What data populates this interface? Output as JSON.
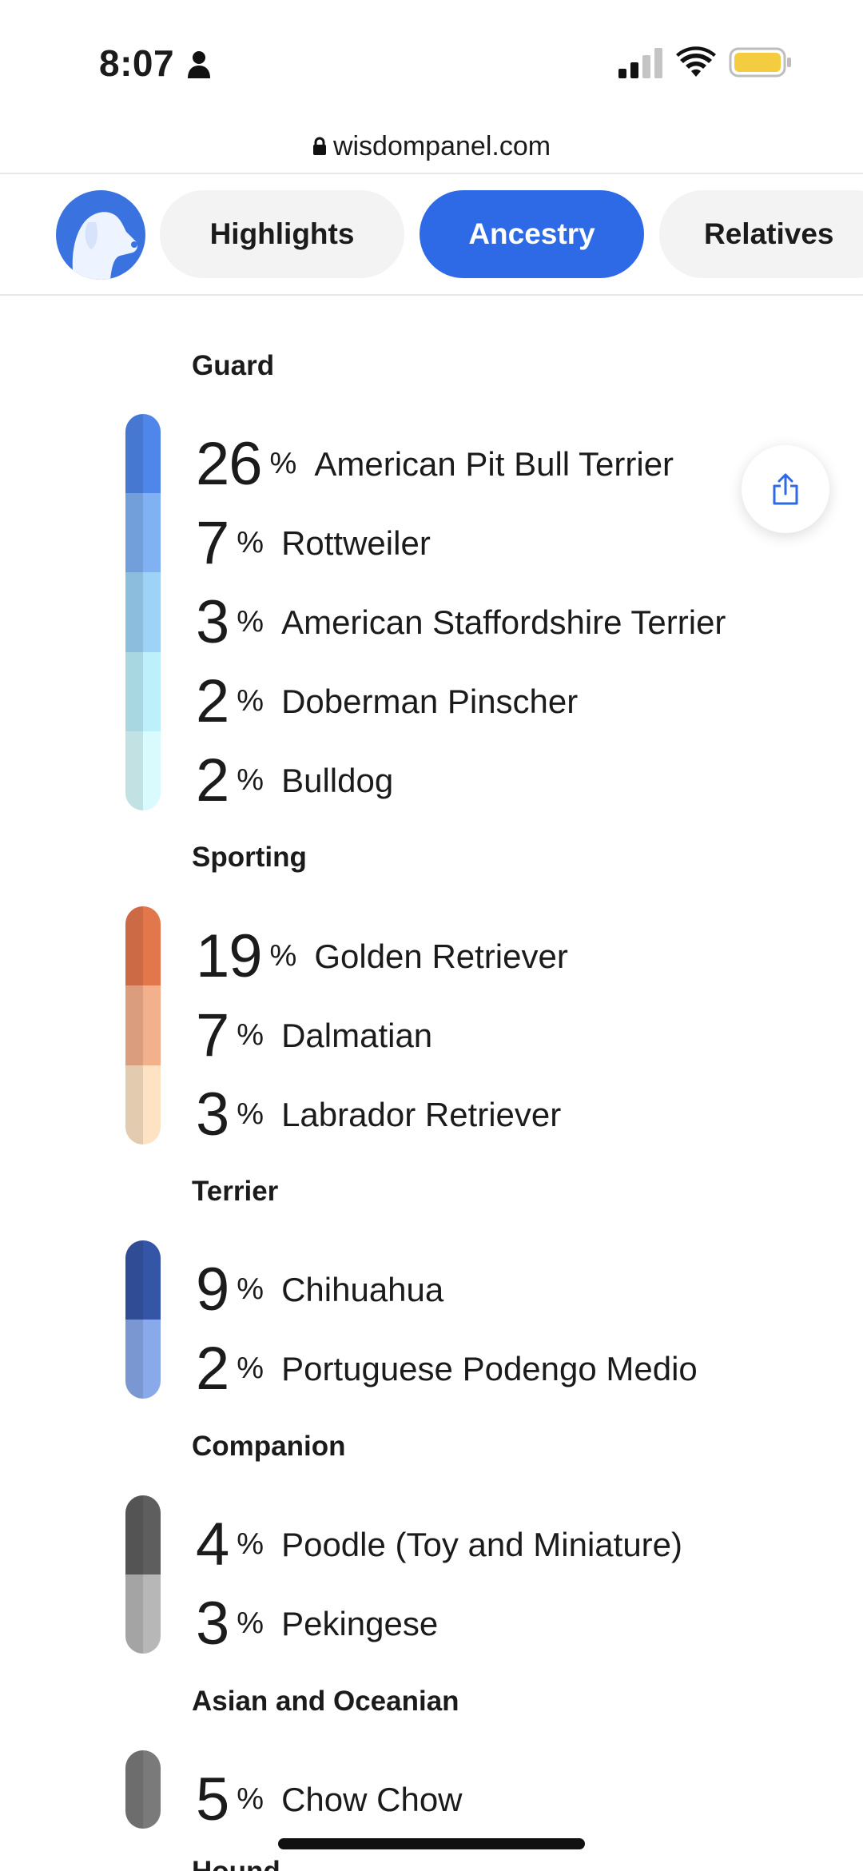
{
  "status_bar": {
    "time": "8:07"
  },
  "url_bar": {
    "domain": "wisdompanel.com"
  },
  "nav": {
    "tabs": [
      {
        "label": "Highlights",
        "active": false
      },
      {
        "label": "Ancestry",
        "active": true
      },
      {
        "label": "Relatives",
        "active": false
      }
    ]
  },
  "groups": [
    {
      "title": "Guard",
      "breeds": [
        {
          "percent": "26",
          "name": "American Pit Bull Terrier",
          "color": "#4f86ea"
        },
        {
          "percent": "7",
          "name": "Rottweiler",
          "color": "#7fb1f3"
        },
        {
          "percent": "3",
          "name": "American Staffordshire Terrier",
          "color": "#9ed3f7"
        },
        {
          "percent": "2",
          "name": "Doberman Pinscher",
          "color": "#bdf0fb"
        },
        {
          "percent": "2",
          "name": "Bulldog",
          "color": "#d9fbfd"
        }
      ]
    },
    {
      "title": "Sporting",
      "breeds": [
        {
          "percent": "19",
          "name": "Golden Retriever",
          "color": "#e2774c"
        },
        {
          "percent": "7",
          "name": "Dalmatian",
          "color": "#f3b08d"
        },
        {
          "percent": "3",
          "name": "Labrador Retriever",
          "color": "#fde3c4"
        }
      ]
    },
    {
      "title": "Terrier",
      "breeds": [
        {
          "percent": "9",
          "name": "Chihuahua",
          "color": "#3555a6"
        },
        {
          "percent": "2",
          "name": "Portuguese Podengo Medio",
          "color": "#8aa9ea"
        }
      ]
    },
    {
      "title": "Companion",
      "breeds": [
        {
          "percent": "4",
          "name": "Poodle (Toy and Miniature)",
          "color": "#5e5e5e"
        },
        {
          "percent": "3",
          "name": "Pekingese",
          "color": "#b7b7b7"
        }
      ]
    },
    {
      "title": "Asian and Oceanian",
      "breeds": [
        {
          "percent": "5",
          "name": "Chow Chow",
          "color": "#7a7a7a"
        }
      ]
    }
  ],
  "percent_symbol": "%",
  "next_group_title_partial": "Hound"
}
